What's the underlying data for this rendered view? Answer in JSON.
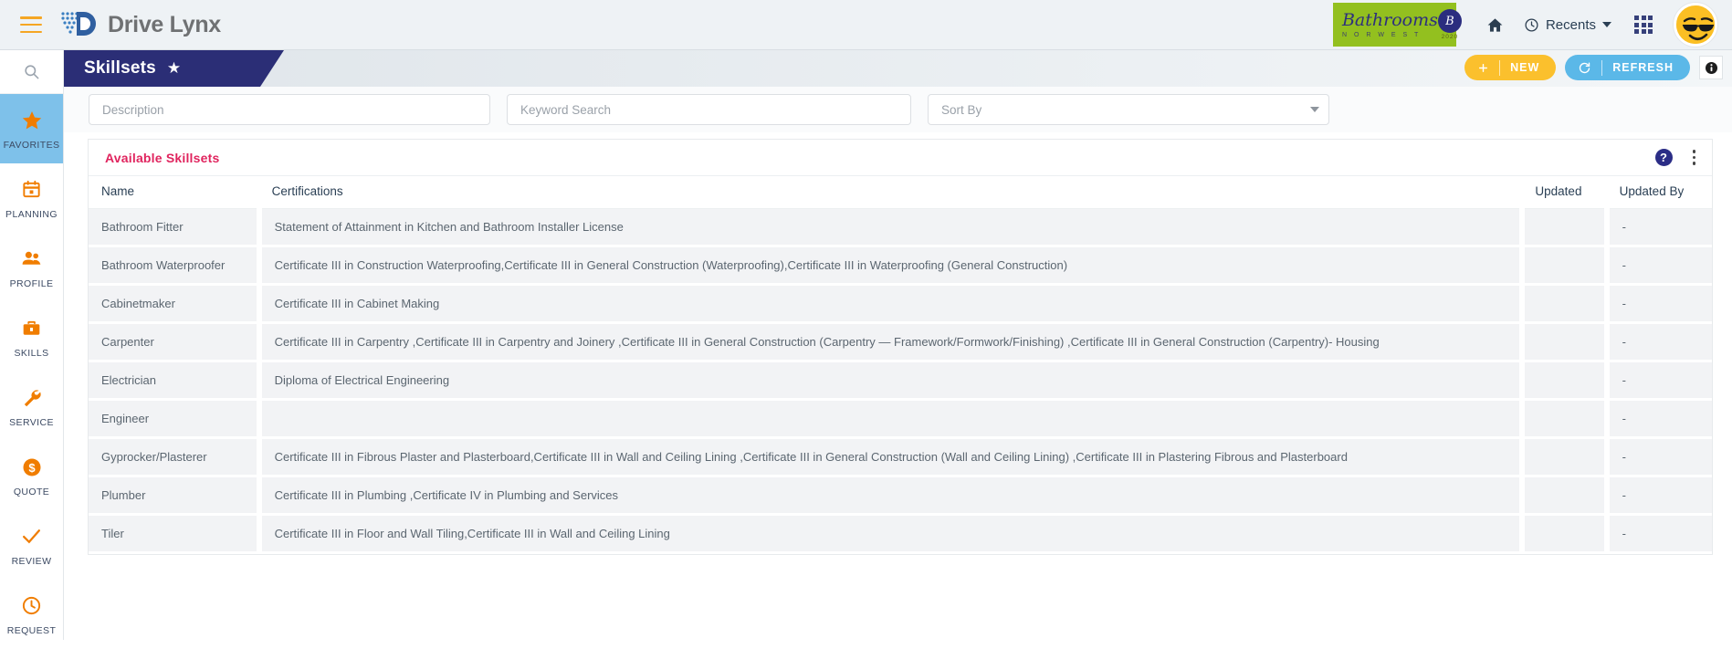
{
  "topbar": {
    "menu_icon": "hamburger-icon",
    "brand": "Drive Lynx",
    "partner": {
      "name": "Bathrooms",
      "sub": "N O R W E S T",
      "seal": "B",
      "year": "2020"
    },
    "home_icon": "home-icon",
    "recents_label": "Recents",
    "apps_icon": "grid-apps-icon",
    "avatar_icon": "avatar-sunglasses-emoji"
  },
  "rail": {
    "search_icon": "search-icon",
    "items": [
      {
        "label": "FAVORITES",
        "icon": "star-icon",
        "active": true
      },
      {
        "label": "PLANNING",
        "icon": "calendar-icon",
        "active": false
      },
      {
        "label": "PROFILE",
        "icon": "people-icon",
        "active": false
      },
      {
        "label": "SKILLS",
        "icon": "briefcase-icon",
        "active": false
      },
      {
        "label": "SERVICE",
        "icon": "wrench-icon",
        "active": false
      },
      {
        "label": "QUOTE",
        "icon": "dollar-coin-icon",
        "active": false
      },
      {
        "label": "REVIEW",
        "icon": "check-icon",
        "active": false
      },
      {
        "label": "REQUEST",
        "icon": "clock-icon",
        "active": false
      }
    ]
  },
  "page": {
    "title": "Skillsets",
    "star_icon": "star-filled-icon",
    "new_label": "NEW",
    "plus_icon": "plus-icon",
    "refresh_label": "REFRESH",
    "refresh_icon": "refresh-icon",
    "info_icon": "info-icon"
  },
  "filters": {
    "description_placeholder": "Description",
    "keyword_placeholder": "Keyword Search",
    "sort_placeholder": "Sort By",
    "sort_caret_icon": "chevron-down-icon"
  },
  "panel": {
    "title": "Available Skillsets",
    "help_icon": "help-question-icon",
    "menu_icon": "kebab-menu-icon",
    "columns": [
      "Name",
      "Certifications",
      "Updated",
      "Updated By"
    ],
    "rows": [
      {
        "name": "Bathroom Fitter",
        "certifications": "Statement of Attainment in Kitchen and Bathroom Installer License",
        "updated": "",
        "updated_by": "-"
      },
      {
        "name": "Bathroom Waterproofer",
        "certifications": "Certificate III in Construction Waterproofing,Certificate III in General Construction (Waterproofing),Certificate III in Waterproofing (General Construction)",
        "updated": "",
        "updated_by": "-"
      },
      {
        "name": "Cabinetmaker",
        "certifications": "Certificate III in Cabinet Making",
        "updated": "",
        "updated_by": "-"
      },
      {
        "name": "Carpenter",
        "certifications": "Certificate III in Carpentry ,Certificate III in Carpentry and Joinery ,Certificate III in General Construction (Carpentry — Framework/Formwork/Finishing) ,Certificate III in General Construction (Carpentry)- Housing",
        "updated": "",
        "updated_by": "-"
      },
      {
        "name": "Electrician",
        "certifications": "Diploma of Electrical Engineering",
        "updated": "",
        "updated_by": "-"
      },
      {
        "name": "Engineer",
        "certifications": "",
        "updated": "",
        "updated_by": "-"
      },
      {
        "name": "Gyprocker/Plasterer",
        "certifications": "Certificate III in Fibrous Plaster and Plasterboard,Certificate III in Wall and Ceiling Lining ,Certificate III in General Construction (Wall and Ceiling Lining) ,Certificate III in Plastering Fibrous and Plasterboard",
        "updated": "",
        "updated_by": "-"
      },
      {
        "name": "Plumber",
        "certifications": "Certificate III in Plumbing ,Certificate IV in Plumbing and Services",
        "updated": "",
        "updated_by": "-"
      },
      {
        "name": "Tiler",
        "certifications": "Certificate III in Floor and Wall Tiling,Certificate III in Wall and Ceiling Lining",
        "updated": "",
        "updated_by": "-"
      }
    ]
  },
  "colors": {
    "brand_navy": "#2b2e76",
    "accent_orange": "#f07d00",
    "new_yellow": "#fbc02d",
    "refresh_blue": "#5bb8e8",
    "panel_pink": "#e0245e",
    "active_rail": "#7ec1ea",
    "partner_green": "#93c01f"
  }
}
